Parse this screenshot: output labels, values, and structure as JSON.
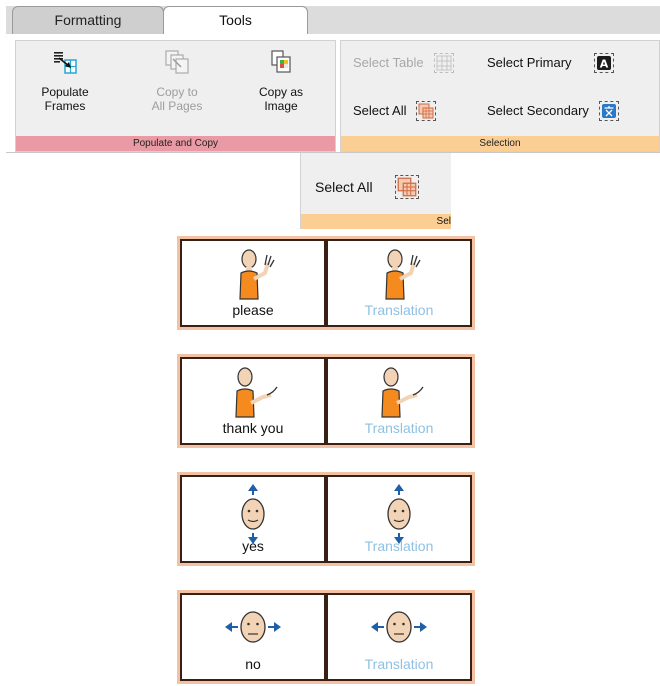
{
  "tabs": [
    "Formatting",
    "Tools"
  ],
  "populate_group": {
    "label": "Populate and Copy",
    "buttons": [
      {
        "line1": "Populate",
        "line2": "Frames",
        "enabled": true
      },
      {
        "line1": "Copy to",
        "line2": "All Pages",
        "enabled": false
      },
      {
        "line1": "Copy as",
        "line2": "Image",
        "enabled": true
      }
    ]
  },
  "selection_group": {
    "label": "Selection",
    "select_table": "Select Table",
    "select_all": "Select All",
    "select_primary": "Select Primary",
    "select_secondary": "Select Secondary"
  },
  "zoom_callout": {
    "button": "Select All",
    "label": "Sel"
  },
  "cards": [
    {
      "word": "please",
      "translation": "Translation",
      "symbol": "person-raised-hand"
    },
    {
      "word": "thank you",
      "translation": "Translation",
      "symbol": "person-offering-hand"
    },
    {
      "word": "yes",
      "translation": "Translation",
      "symbol": "face-nodding"
    },
    {
      "word": "no",
      "translation": "Translation",
      "symbol": "face-shaking"
    }
  ]
}
